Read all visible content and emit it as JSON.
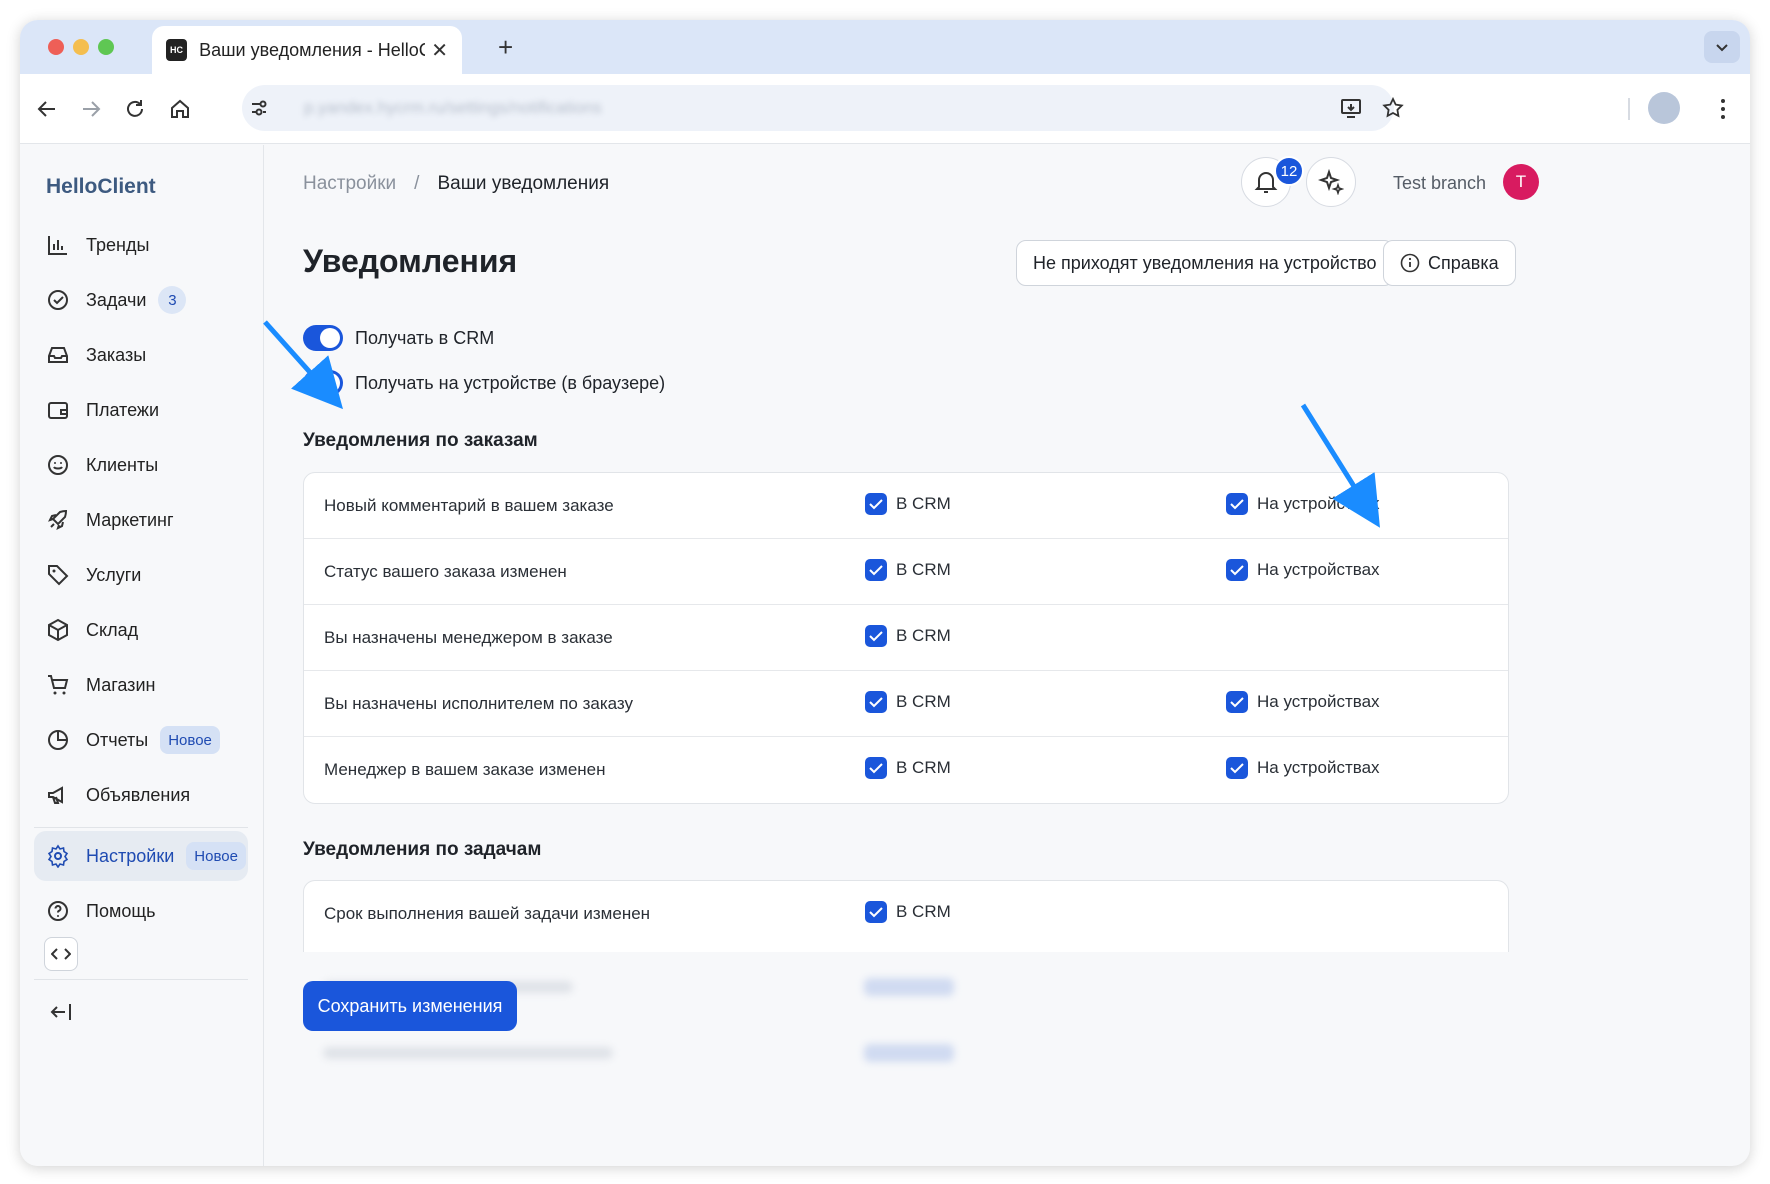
{
  "browser": {
    "tab_title": "Ваши уведомления - HelloClient",
    "favicon_text": "HC",
    "url": "p.yandex.hycrm.ru/settings/notifications"
  },
  "sidebar": {
    "brand": "HelloClient",
    "items": [
      {
        "label": "Тренды",
        "icon": "bar-chart-icon"
      },
      {
        "label": "Задачи",
        "icon": "check-circle-icon",
        "badge": "3"
      },
      {
        "label": "Заказы",
        "icon": "inbox-icon"
      },
      {
        "label": "Платежи",
        "icon": "wallet-icon"
      },
      {
        "label": "Клиенты",
        "icon": "smile-icon"
      },
      {
        "label": "Маркетинг",
        "icon": "rocket-icon"
      },
      {
        "label": "Услуги",
        "icon": "tag-icon"
      },
      {
        "label": "Склад",
        "icon": "box-icon"
      },
      {
        "label": "Магазин",
        "icon": "cart-icon"
      },
      {
        "label": "Отчеты",
        "icon": "pie-chart-icon",
        "tag": "Новое"
      },
      {
        "label": "Объявления",
        "icon": "megaphone-icon"
      }
    ],
    "settings": {
      "label": "Настройки",
      "tag": "Новое",
      "icon": "gear-icon"
    },
    "help": {
      "label": "Помощь",
      "icon": "question-circle-icon"
    }
  },
  "header": {
    "breadcrumb_root": "Настройки",
    "breadcrumb_sep": "/",
    "breadcrumb_current": "Ваши уведомления",
    "notif_count": "12",
    "branch": "Test branch",
    "avatar_letter": "T"
  },
  "page": {
    "title": "Уведомления",
    "btn_device_issue": "Не приходят уведомления на устройство",
    "btn_help": "Справка",
    "toggle_crm": "Получать в CRM",
    "toggle_device": "Получать на устройстве (в браузере)",
    "orders_section": "Уведомления по заказам",
    "tasks_section": "Уведомления по задачам",
    "crm_label": "В CRM",
    "device_label": "На устройствах",
    "order_rows": [
      {
        "label": "Новый комментарий в вашем заказе",
        "crm": true,
        "device": true
      },
      {
        "label": "Статус вашего заказа изменен",
        "crm": true,
        "device": true
      },
      {
        "label": "Вы назначены менеджером в заказе",
        "crm": true,
        "device": false
      },
      {
        "label": "Вы назначены исполнителем по заказу",
        "crm": true,
        "device": true
      },
      {
        "label": "Менеджер в вашем заказе изменен",
        "crm": true,
        "device": true
      }
    ],
    "task_rows": [
      {
        "label": "Срок выполнения вашей задачи изменен",
        "crm": true,
        "device": false
      }
    ],
    "save_button": "Сохранить изменения"
  },
  "colors": {
    "accent": "#1a56db",
    "avatar": "#d81b60",
    "arrow": "#1a8cff"
  }
}
